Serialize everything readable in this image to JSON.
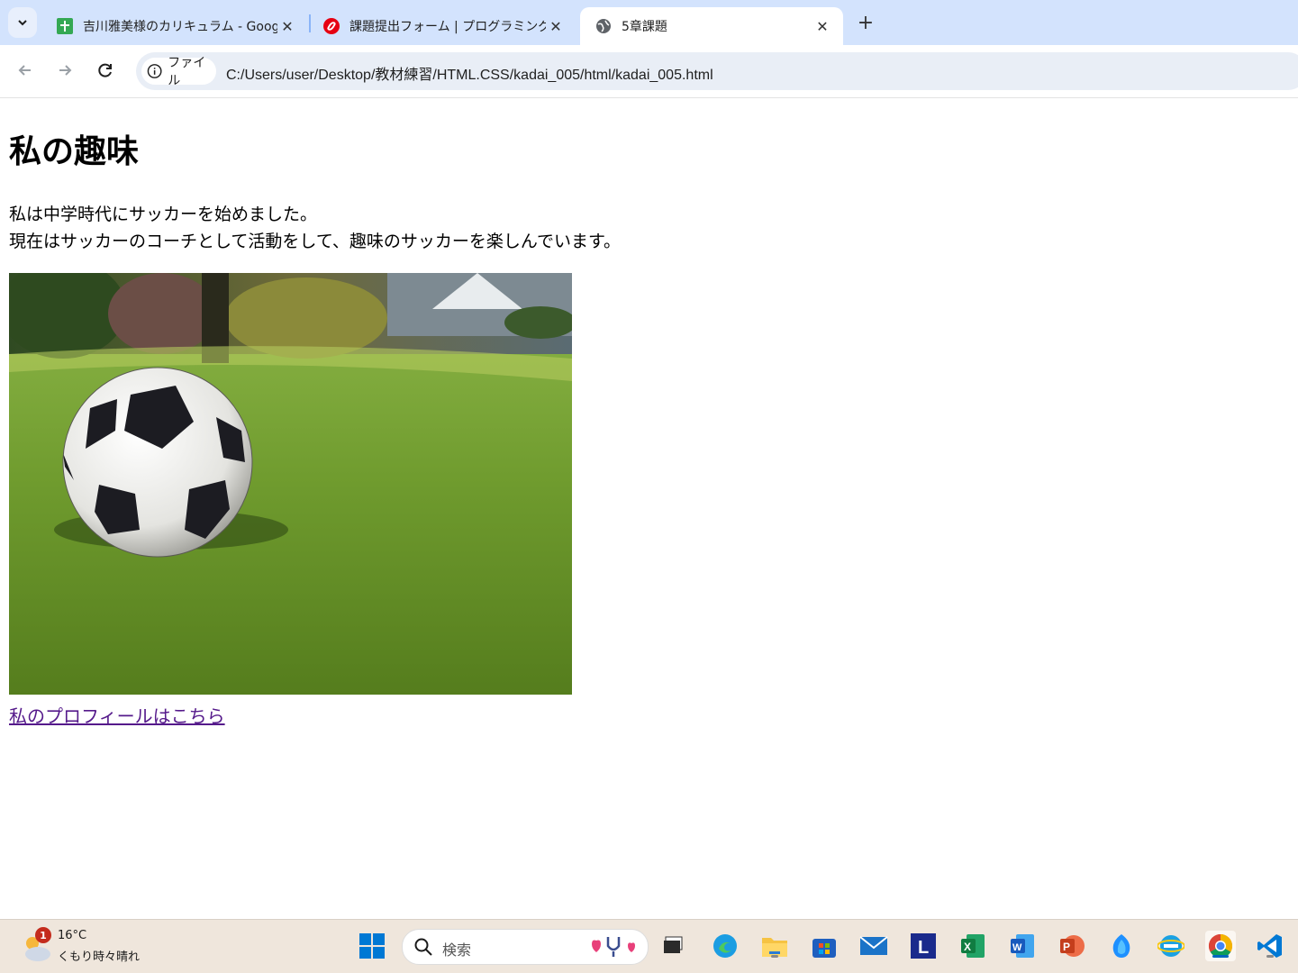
{
  "browser": {
    "tabs": [
      {
        "title": "吉川雅美様のカリキュラム - Google",
        "favicon": "sheets-icon"
      },
      {
        "title": "課題提出フォーム | プログラミング学習",
        "favicon": "samurai-icon"
      },
      {
        "title": "5章課題",
        "favicon": "globe-icon",
        "active": true
      }
    ],
    "address": {
      "chip_label": "ファイル",
      "url": "C:/Users/user/Desktop/教材練習/HTML.CSS/kadai_005/html/kadai_005.html"
    }
  },
  "page": {
    "heading": "私の趣味",
    "paragraph_line1": "私は中学時代にサッカーを始めました。",
    "paragraph_line2": "現在はサッカーのコーチとして活動をして、趣味のサッカーを楽しんでいます。",
    "image_subject": "soccer ball on grass",
    "link_text": "私のプロフィールはこちら"
  },
  "taskbar": {
    "weather": {
      "temp": "16°C",
      "condition": "くもり時々晴れ",
      "badge": "1"
    },
    "search_placeholder": "検索",
    "apps": [
      "start-icon",
      "task-view-icon",
      "edge-icon",
      "file-explorer-icon",
      "store-icon",
      "mail-icon",
      "l-app-icon",
      "excel-icon",
      "word-icon",
      "powerpoint-icon",
      "copilot-icon",
      "ie-icon",
      "chrome-icon",
      "vscode-icon"
    ]
  },
  "colors": {
    "tabbar": "#d3e3fd",
    "link_visited": "#551a8b",
    "taskbar": "#efe6dc"
  }
}
